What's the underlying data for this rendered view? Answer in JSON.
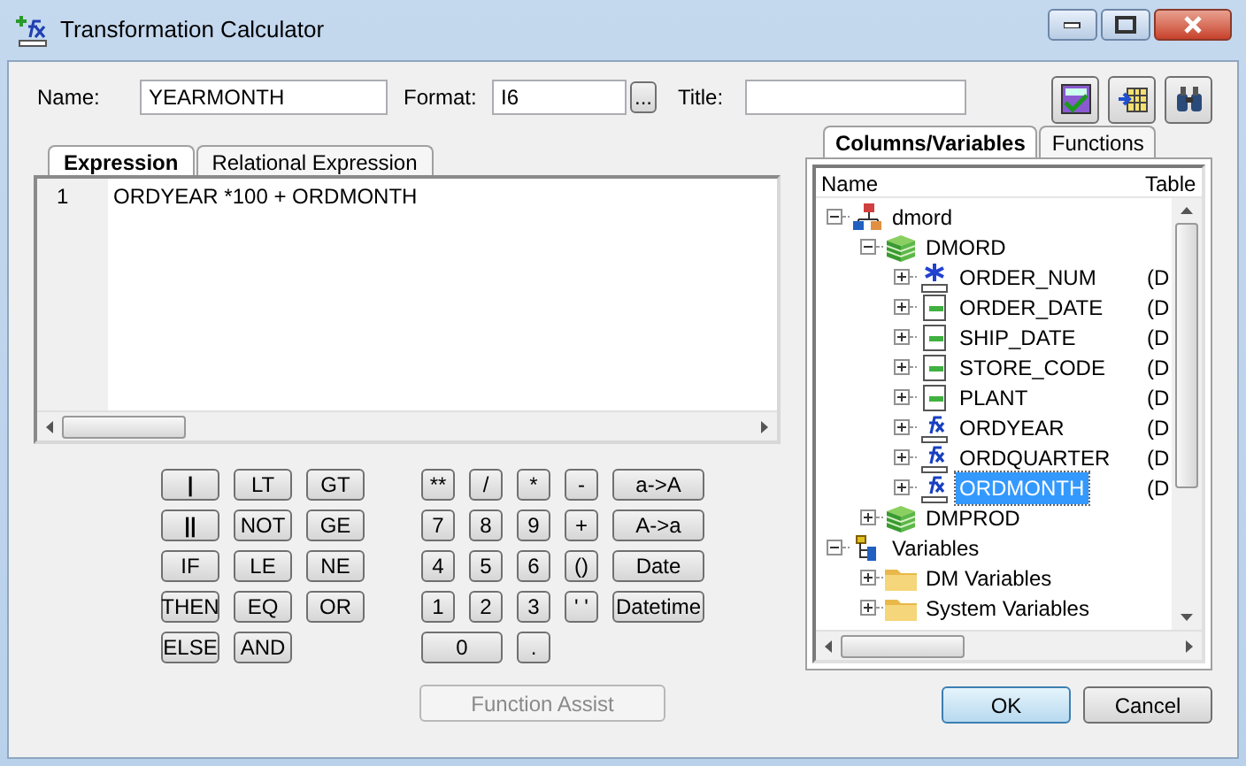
{
  "window": {
    "title": "Transformation Calculator"
  },
  "fields": [
    {
      "label": "Name:",
      "value": "YEARMONTH"
    },
    {
      "label": "Format:",
      "value": "I6",
      "browse": "..."
    },
    {
      "label": "Title:"
    }
  ],
  "editor_tabs": [
    {
      "label": "Expression",
      "selected": true
    },
    {
      "label": "Relational Expression",
      "selected": false
    }
  ],
  "editor": {
    "lines": [
      {
        "number": "1",
        "text": "ORDYEAR *100 + ORDMONTH"
      }
    ]
  },
  "logic_keys": [
    {
      "label": "|",
      "kind": "glyph"
    },
    {
      "label": "LT",
      "kind": "key"
    },
    {
      "label": "GT",
      "kind": "key"
    },
    {
      "label": "||",
      "kind": "glyph"
    },
    {
      "label": "NOT",
      "kind": "key"
    },
    {
      "label": "GE",
      "kind": "key"
    },
    {
      "label": "IF",
      "kind": "key"
    },
    {
      "label": "LE",
      "kind": "key"
    },
    {
      "label": "NE",
      "kind": "key"
    },
    {
      "label": "THEN",
      "kind": "key"
    },
    {
      "label": "EQ",
      "kind": "key"
    },
    {
      "label": "OR",
      "kind": "key"
    },
    {
      "label": "ELSE",
      "kind": "key"
    },
    {
      "label": "AND",
      "kind": "key"
    }
  ],
  "math_keys": [
    {
      "label": "**",
      "kind": "key"
    },
    {
      "label": "/",
      "kind": "key"
    },
    {
      "label": "*",
      "kind": "key"
    },
    {
      "label": "-",
      "kind": "key"
    },
    {
      "label": "a->A",
      "kind": "wide"
    },
    {
      "label": "7",
      "kind": "key"
    },
    {
      "label": "8",
      "kind": "key"
    },
    {
      "label": "9",
      "kind": "key"
    },
    {
      "label": "+",
      "kind": "key"
    },
    {
      "label": "A->a",
      "kind": "wide"
    },
    {
      "label": "4",
      "kind": "key"
    },
    {
      "label": "5",
      "kind": "key"
    },
    {
      "label": "6",
      "kind": "key"
    },
    {
      "label": "()",
      "kind": "key"
    },
    {
      "label": "Date",
      "kind": "wide"
    },
    {
      "label": "1",
      "kind": "key"
    },
    {
      "label": "2",
      "kind": "key"
    },
    {
      "label": "3",
      "kind": "key"
    },
    {
      "label": "' '",
      "kind": "key"
    },
    {
      "label": "Datetime",
      "kind": "wide"
    },
    {
      "label": "0",
      "kind": "double"
    },
    {
      "label": ".",
      "kind": "key"
    }
  ],
  "function_assist": {
    "label": "Function Assist",
    "disabled": true
  },
  "side_tabs": [
    {
      "label": "Columns/Variables",
      "selected": true
    },
    {
      "label": "Functions",
      "selected": false
    }
  ],
  "tree": {
    "columns": [
      "Name",
      "Table"
    ],
    "items": [
      {
        "label": "dmord",
        "kind": "server",
        "expanded": true,
        "selected": false,
        "children": [
          {
            "label": "DMORD",
            "kind": "table",
            "expanded": true,
            "selected": false,
            "children": [
              {
                "label": "ORDER_NUM",
                "kind": "key_column",
                "expanded": false,
                "selected": false,
                "table": "(D"
              },
              {
                "label": "ORDER_DATE",
                "kind": "column",
                "expanded": false,
                "selected": false,
                "table": "(D"
              },
              {
                "label": "SHIP_DATE",
                "kind": "column",
                "expanded": false,
                "selected": false,
                "table": "(D"
              },
              {
                "label": "STORE_CODE",
                "kind": "column",
                "expanded": false,
                "selected": false,
                "table": "(D"
              },
              {
                "label": "PLANT",
                "kind": "column",
                "expanded": false,
                "selected": false,
                "table": "(D"
              },
              {
                "label": "ORDYEAR",
                "kind": "computed",
                "expanded": false,
                "selected": false,
                "table": "(D"
              },
              {
                "label": "ORDQUARTER",
                "kind": "computed",
                "expanded": false,
                "selected": false,
                "table": "(D"
              },
              {
                "label": "ORDMONTH",
                "kind": "computed",
                "expanded": false,
                "selected": true,
                "table": "(D"
              }
            ]
          },
          {
            "label": "DMPROD",
            "kind": "table",
            "expanded": false,
            "selected": false
          }
        ]
      },
      {
        "label": "Variables",
        "kind": "variables",
        "expanded": true,
        "selected": false,
        "children": [
          {
            "label": "DM Variables",
            "kind": "folder",
            "expanded": false,
            "selected": false
          },
          {
            "label": "System Variables",
            "kind": "folder",
            "expanded": false,
            "selected": false
          }
        ]
      }
    ]
  },
  "buttons": [
    {
      "label": "OK",
      "default": true
    },
    {
      "label": "Cancel",
      "default": false
    }
  ]
}
